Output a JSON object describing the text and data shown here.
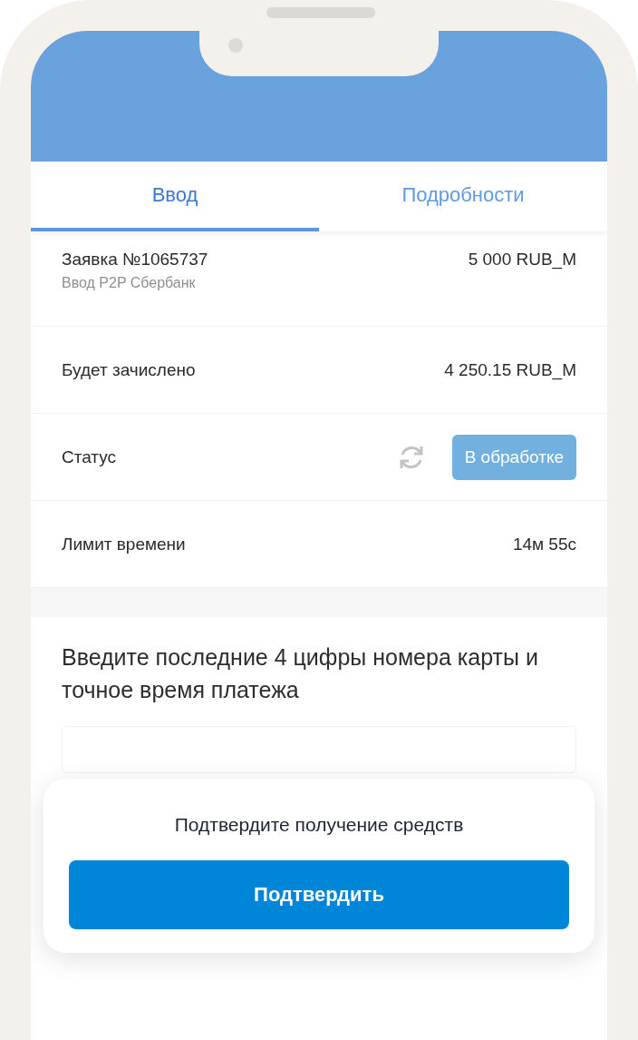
{
  "tabs": [
    {
      "label": "Ввод",
      "selected": true
    },
    {
      "label": "Подробности",
      "selected": false
    }
  ],
  "order": {
    "title": "Заявка №1065737",
    "subtitle": "Ввод P2P Сбербанк",
    "amount": "5 000 RUB_M"
  },
  "rows": [
    {
      "kind": "value",
      "label": "Будет зачислено",
      "value": "4 250.15 RUB_M"
    },
    {
      "kind": "status",
      "label": "Статус",
      "value": "В обработке"
    },
    {
      "kind": "value",
      "label": "Лимит времени",
      "value": "14м 55с"
    }
  ],
  "card_prompt": {
    "text": "Введите последние 4 цифры номера карты и точное время платежа"
  },
  "confirm_sheet": {
    "message": "Подтвердите получение средств",
    "button": "Подтвердить"
  }
}
